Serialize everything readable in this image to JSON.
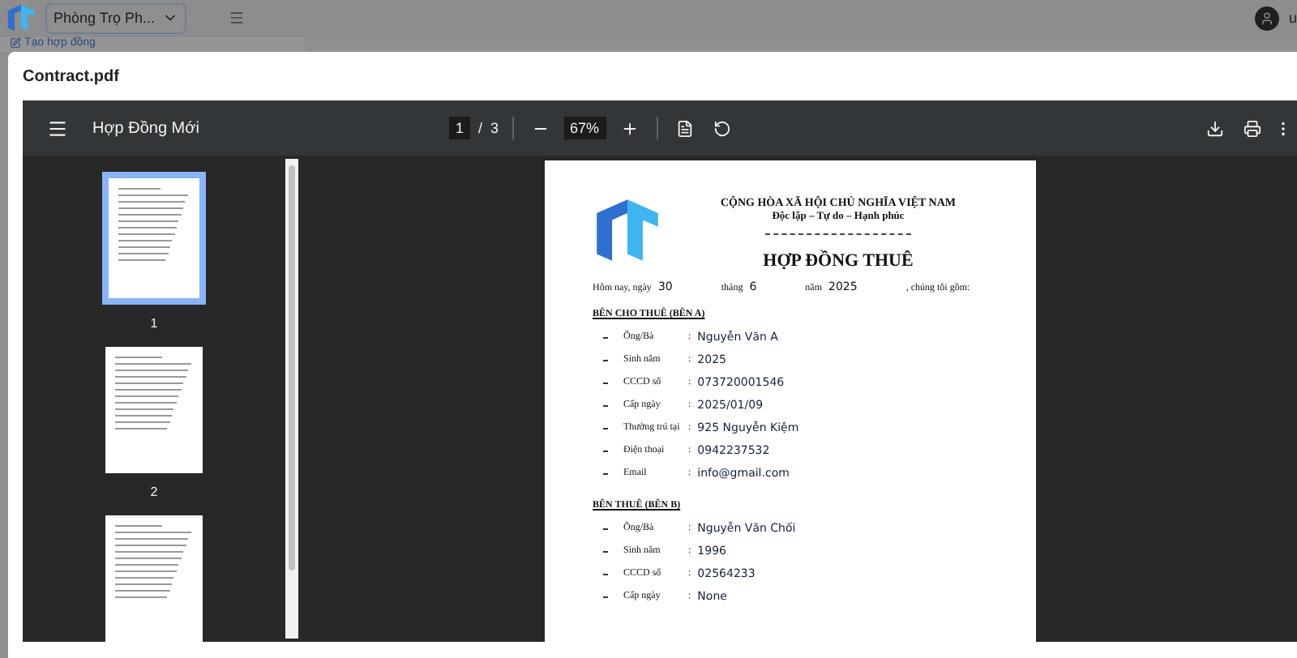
{
  "app": {
    "branch_select": "Phòng Trọ Ph...",
    "sidebar_link": "Tạo hợp đồng",
    "user_name": "u"
  },
  "modal": {
    "title": "Contract.pdf"
  },
  "viewer": {
    "doc_title": "Hợp Đồng Mới",
    "page_current": "1",
    "page_separator": "/",
    "page_total": "3",
    "zoom": "67%"
  },
  "thumbnails": [
    {
      "label": "1",
      "selected": true
    },
    {
      "label": "2",
      "selected": false
    },
    {
      "selected": false
    }
  ],
  "document": {
    "heading": "CỘNG HÒA XÃ HỘI CHỦ NGHĨA VIỆT NAM",
    "motto": "Độc lập – Tự do – Hạnh phúc",
    "title": "HỢP ĐỒNG THUÊ",
    "date_line": [
      {
        "kind": "label",
        "text": "Hôm nay, ngày"
      },
      {
        "kind": "value",
        "text": "30"
      },
      {
        "kind": "label",
        "text": "tháng"
      },
      {
        "kind": "value",
        "text": "6"
      },
      {
        "kind": "label",
        "text": "năm"
      },
      {
        "kind": "value",
        "text": "2025"
      },
      {
        "kind": "label",
        "text": ", chúng tôi gồm:"
      }
    ],
    "sections": [
      {
        "heading": "BÊN CHO THUÊ (BÊN A)",
        "rows": [
          {
            "label": "Ông/Bà",
            "separator": ":",
            "value": "Nguyễn Văn A"
          },
          {
            "label": "Sinh năm",
            "separator": ":",
            "value": "2025"
          },
          {
            "label": "CCCD số",
            "separator": ":",
            "value": "073720001546"
          },
          {
            "label": "Cấp ngày",
            "separator": ":",
            "value": "2025/01/09"
          },
          {
            "label": "Thường trú tại",
            "separator": ":",
            "value": "925 Nguyễn Kiệm"
          },
          {
            "label": "Điện thoại",
            "separator": ":",
            "value": "0942237532"
          },
          {
            "label": "Email",
            "separator": ":",
            "value": "info@gmail.com"
          }
        ]
      },
      {
        "heading": "BÊN THUÊ (BÊN B)",
        "rows": [
          {
            "label": "Ông/Bà",
            "separator": ":",
            "value": "Nguyễn Văn Chối"
          },
          {
            "label": "Sinh năm",
            "separator": ":",
            "value": "1996"
          },
          {
            "label": "CCCD số",
            "separator": ":",
            "value": "02564233"
          },
          {
            "label": "Cấp ngày",
            "separator": ":",
            "value": "None"
          }
        ]
      }
    ]
  }
}
